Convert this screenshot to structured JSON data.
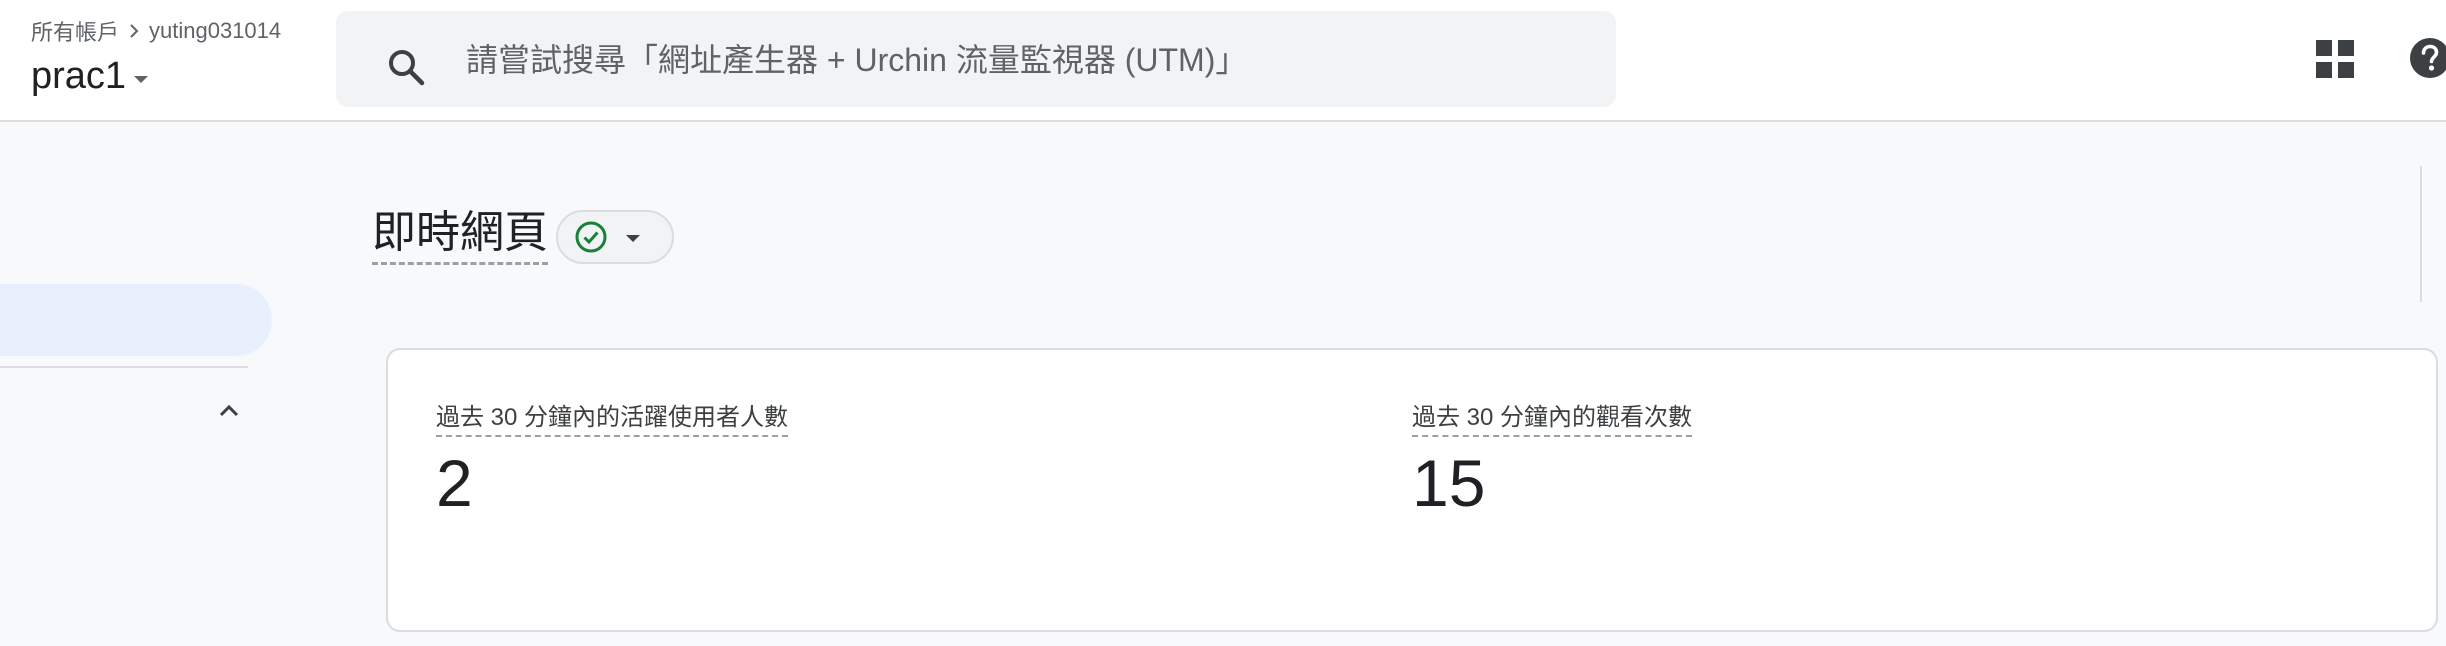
{
  "header": {
    "breadcrumb": {
      "root": "所有帳戶",
      "account": "yuting031014"
    },
    "property": "prac1",
    "search": {
      "placeholder": "請嘗試搜尋「網址產生器 + Urchin 流量監視器 (UTM)」",
      "value": ""
    },
    "icons": [
      "search-icon",
      "apps-grid-icon",
      "help-icon"
    ]
  },
  "page": {
    "title": "即時網頁",
    "status_icon": "check-circle-icon"
  },
  "metrics": [
    {
      "label": "過去 30 分鐘內的活躍使用者人數",
      "value": "2"
    },
    {
      "label": "過去 30 分鐘內的觀看次數",
      "value": "15"
    }
  ],
  "colors": {
    "accent_green": "#188038",
    "nav_active": "#e8f0fe",
    "page_background": "#f7f9fb"
  }
}
